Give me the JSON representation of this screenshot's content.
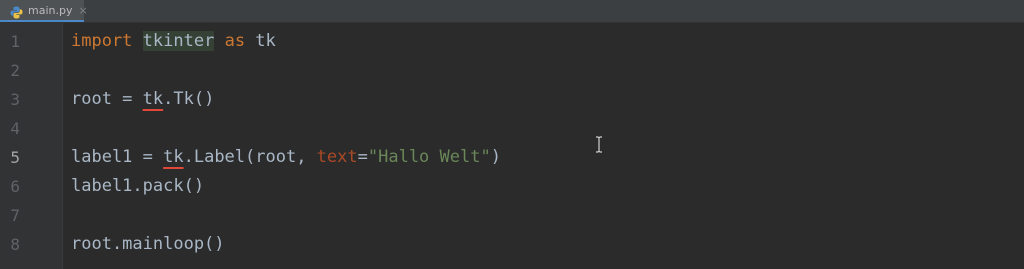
{
  "tab": {
    "filename": "main.py",
    "close_glyph": "×",
    "icon": "python-file-icon"
  },
  "colors": {
    "keyword": "#cc7832",
    "string": "#6a8759",
    "param": "#aa4926",
    "default": "#a9b7c6",
    "error_underline": "#e0493a",
    "background": "#2b2b2b"
  },
  "editor": {
    "current_line": 5,
    "lines": [
      {
        "number": "1",
        "tokens": [
          "import",
          " ",
          "tkinter",
          " ",
          "as",
          " tk"
        ]
      },
      {
        "number": "2",
        "tokens": []
      },
      {
        "number": "3",
        "tokens": [
          "root = ",
          "tk",
          ".Tk()"
        ]
      },
      {
        "number": "4",
        "tokens": []
      },
      {
        "number": "5",
        "tokens": [
          "label1 = ",
          "tk",
          ".Label(root, ",
          "text",
          "=",
          "\"Hallo Welt\"",
          ")"
        ]
      },
      {
        "number": "6",
        "tokens": [
          "label1.pack()"
        ]
      },
      {
        "number": "7",
        "tokens": []
      },
      {
        "number": "8",
        "tokens": [
          "root.mainloop()"
        ]
      }
    ]
  }
}
